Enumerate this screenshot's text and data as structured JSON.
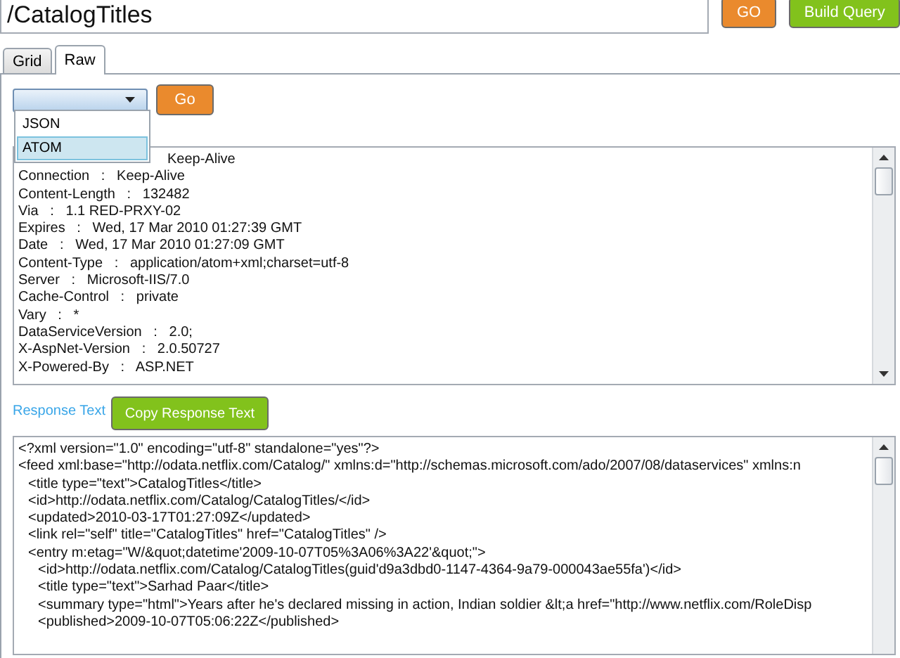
{
  "query": {
    "value": "/CatalogTitles"
  },
  "buttons": {
    "go": "GO",
    "build": "Build Query"
  },
  "tabs": [
    {
      "label": "Grid",
      "selected": false
    },
    {
      "label": "Raw",
      "selected": true
    }
  ],
  "format_select": {
    "options": [
      {
        "label": "JSON",
        "selected": false
      },
      {
        "label": "ATOM",
        "selected": true
      }
    ],
    "expanded": true
  },
  "go_button": "Go",
  "headers": [
    {
      "kind": "covered",
      "text": "Keep-Alive"
    },
    {
      "kind": "header",
      "text": "Connection   :   Keep-Alive"
    },
    {
      "kind": "header",
      "text": "Content-Length   :   132482"
    },
    {
      "kind": "header",
      "text": "Via   :   1.1 RED-PRXY-02"
    },
    {
      "kind": "header",
      "text": "Expires   :   Wed, 17 Mar 2010 01:27:39 GMT"
    },
    {
      "kind": "header",
      "text": "Date   :   Wed, 17 Mar 2010 01:27:09 GMT"
    },
    {
      "kind": "header",
      "text": "Content-Type   :   application/atom+xml;charset=utf-8"
    },
    {
      "kind": "header",
      "text": "Server   :   Microsoft-IIS/7.0"
    },
    {
      "kind": "header",
      "text": "Cache-Control   :   private"
    },
    {
      "kind": "header",
      "text": "Vary   :   *"
    },
    {
      "kind": "header",
      "text": "DataServiceVersion   :   2.0;"
    },
    {
      "kind": "header",
      "text": "X-AspNet-Version   :   2.0.50727"
    },
    {
      "kind": "header",
      "text": "X-Powered-By   :   ASP.NET"
    }
  ],
  "response_label": "Response Text",
  "copy_button": "Copy Response Text",
  "xml": [
    {
      "text": "<?xml version=\"1.0\" encoding=\"utf-8\" standalone=\"yes\"?>"
    },
    {
      "text": "<feed xml:base=\"http://odata.netflix.com/Catalog/\" xmlns:d=\"http://schemas.microsoft.com/ado/2007/08/dataservices\" xmlns:n",
      "children": [
        {
          "text": "<title type=\"text\">CatalogTitles</title>"
        },
        {
          "text": "<id>http://odata.netflix.com/Catalog/CatalogTitles/</id>"
        },
        {
          "text": "<updated>2010-03-17T01:27:09Z</updated>"
        },
        {
          "text": "<link rel=\"self\" title=\"CatalogTitles\" href=\"CatalogTitles\" />"
        },
        {
          "text": "<entry m:etag=\"W/&quot;datetime'2009-10-07T05%3A06%3A22'&quot;\">",
          "children": [
            {
              "text": "<id>http://odata.netflix.com/Catalog/CatalogTitles(guid'd9a3dbd0-1147-4364-9a79-000043ae55fa')</id>"
            },
            {
              "text": "<title type=\"text\">Sarhad Paar</title>"
            },
            {
              "text": "<summary type=\"html\">Years after he's declared missing in action, Indian soldier &lt;a href=\"http://www.netflix.com/RoleDisp"
            },
            {
              "text": "<published>2009-10-07T05:06:22Z</published>"
            }
          ]
        }
      ]
    }
  ]
}
